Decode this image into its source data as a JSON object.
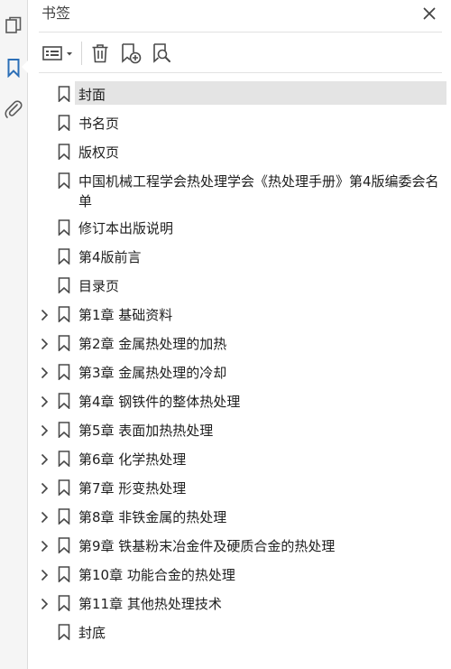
{
  "panel": {
    "title": "书签"
  },
  "rail": {
    "items": [
      {
        "name": "page-thumbnails-icon"
      },
      {
        "name": "bookmark-icon",
        "active": true
      },
      {
        "name": "attachment-icon"
      }
    ],
    "accent_color": "#2c6fb7"
  },
  "toolbar": {
    "items": [
      {
        "name": "options-menu-icon"
      },
      {
        "name": "delete-icon"
      },
      {
        "name": "new-bookmark-icon"
      },
      {
        "name": "bookmark-search-icon"
      }
    ]
  },
  "bookmarks": [
    {
      "label": "封面",
      "expandable": false,
      "selected": true
    },
    {
      "label": "书名页",
      "expandable": false
    },
    {
      "label": "版权页",
      "expandable": false
    },
    {
      "label": "中国机械工程学会热处理学会《热处理手册》第4版编委会名单",
      "expandable": false
    },
    {
      "label": "修订本出版说明",
      "expandable": false
    },
    {
      "label": "第4版前言",
      "expandable": false
    },
    {
      "label": "目录页",
      "expandable": false
    },
    {
      "label": "第1章  基础资料",
      "expandable": true
    },
    {
      "label": "第2章  金属热处理的加热",
      "expandable": true
    },
    {
      "label": "第3章  金属热处理的冷却",
      "expandable": true
    },
    {
      "label": "第4章  钢铁件的整体热处理",
      "expandable": true
    },
    {
      "label": "第5章  表面加热热处理",
      "expandable": true
    },
    {
      "label": "第6章  化学热处理",
      "expandable": true
    },
    {
      "label": "第7章  形变热处理",
      "expandable": true
    },
    {
      "label": "第8章  非铁金属的热处理",
      "expandable": true
    },
    {
      "label": "第9章  铁基粉末冶金件及硬质合金的热处理",
      "expandable": true
    },
    {
      "label": "第10章  功能合金的热处理",
      "expandable": true
    },
    {
      "label": "第11章  其他热处理技术",
      "expandable": true
    },
    {
      "label": "封底",
      "expandable": false
    }
  ]
}
